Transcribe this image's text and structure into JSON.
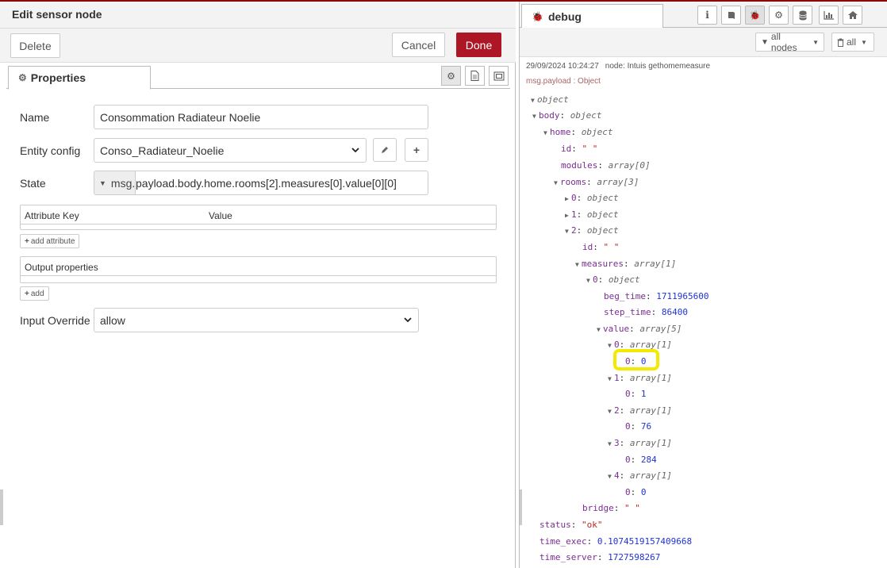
{
  "edit_panel": {
    "title": "Edit sensor node",
    "delete_label": "Delete",
    "cancel_label": "Cancel",
    "done_label": "Done",
    "tab_properties": "Properties",
    "fields": {
      "name_label": "Name",
      "name_value": "Consommation Radiateur Noelie",
      "entity_label": "Entity config",
      "entity_value": "Conso_Radiateur_Noelie",
      "state_label": "State",
      "state_type": "msg.",
      "state_value": "payload.body.home.rooms[2].measures[0].value[0][0]",
      "attr_key_header": "Attribute Key",
      "attr_value_header": "Value",
      "add_attribute_label": "add attribute",
      "output_header": "Output properties",
      "add_label": "add",
      "override_label": "Input Override",
      "override_value": "allow"
    }
  },
  "sidebar": {
    "tab_label": "debug",
    "filter_nodes": "all nodes",
    "clear_filter": "all",
    "message": {
      "timestamp": "29/09/2024 10:24:27",
      "node": "node: Intuis gethomemeasure",
      "path": "msg.payload : Object",
      "root_type": "object",
      "body_key": "body",
      "body_type": "object",
      "home_key": "home",
      "home_type": "object",
      "id_key": "id",
      "id_value": "\"                        \"",
      "modules_key": "modules",
      "modules_type": "array[0]",
      "rooms_key": "rooms",
      "rooms_type": "array[3]",
      "room0_key": "0",
      "room0_type": "object",
      "room1_key": "1",
      "room1_type": "object",
      "room2_key": "2",
      "room2_type": "object",
      "room_id_key": "id",
      "room_id_value": "\"          \"",
      "measures_key": "measures",
      "measures_type": "array[1]",
      "measure0_key": "0",
      "measure0_type": "object",
      "beg_time_key": "beg_time",
      "beg_time_value": "1711965600",
      "step_time_key": "step_time",
      "step_time_value": "86400",
      "value_key": "value",
      "value_type": "array[5]",
      "values": [
        {
          "key": "0",
          "type": "array[1]",
          "inner_key": "0",
          "inner_value": "0"
        },
        {
          "key": "1",
          "type": "array[1]",
          "inner_key": "0",
          "inner_value": "1"
        },
        {
          "key": "2",
          "type": "array[1]",
          "inner_key": "0",
          "inner_value": "76"
        },
        {
          "key": "3",
          "type": "array[1]",
          "inner_key": "0",
          "inner_value": "284"
        },
        {
          "key": "4",
          "type": "array[1]",
          "inner_key": "0",
          "inner_value": "0"
        }
      ],
      "bridge_key": "bridge",
      "bridge_value": "\"                    \"",
      "status_key": "status",
      "status_value": "\"ok\"",
      "time_exec_key": "time_exec",
      "time_exec_value": "0.1074519157409668",
      "time_server_key": "time_server",
      "time_server_value": "1727598267"
    }
  },
  "colors": {
    "done_button": "#ad1625",
    "highlight": "#f4ea00",
    "key": "#792e90",
    "number": "#2033d6",
    "string": "#b72828"
  },
  "icons": [
    "gear-icon",
    "document-icon",
    "appearance-icon",
    "pencil-icon",
    "plus-icon",
    "bug-icon",
    "info-icon",
    "book-icon",
    "database-icon",
    "chart-icon",
    "home-icon",
    "filter-icon",
    "trash-icon",
    "chevron-down-icon",
    "caret-down-icon",
    "caret-right-icon"
  ]
}
